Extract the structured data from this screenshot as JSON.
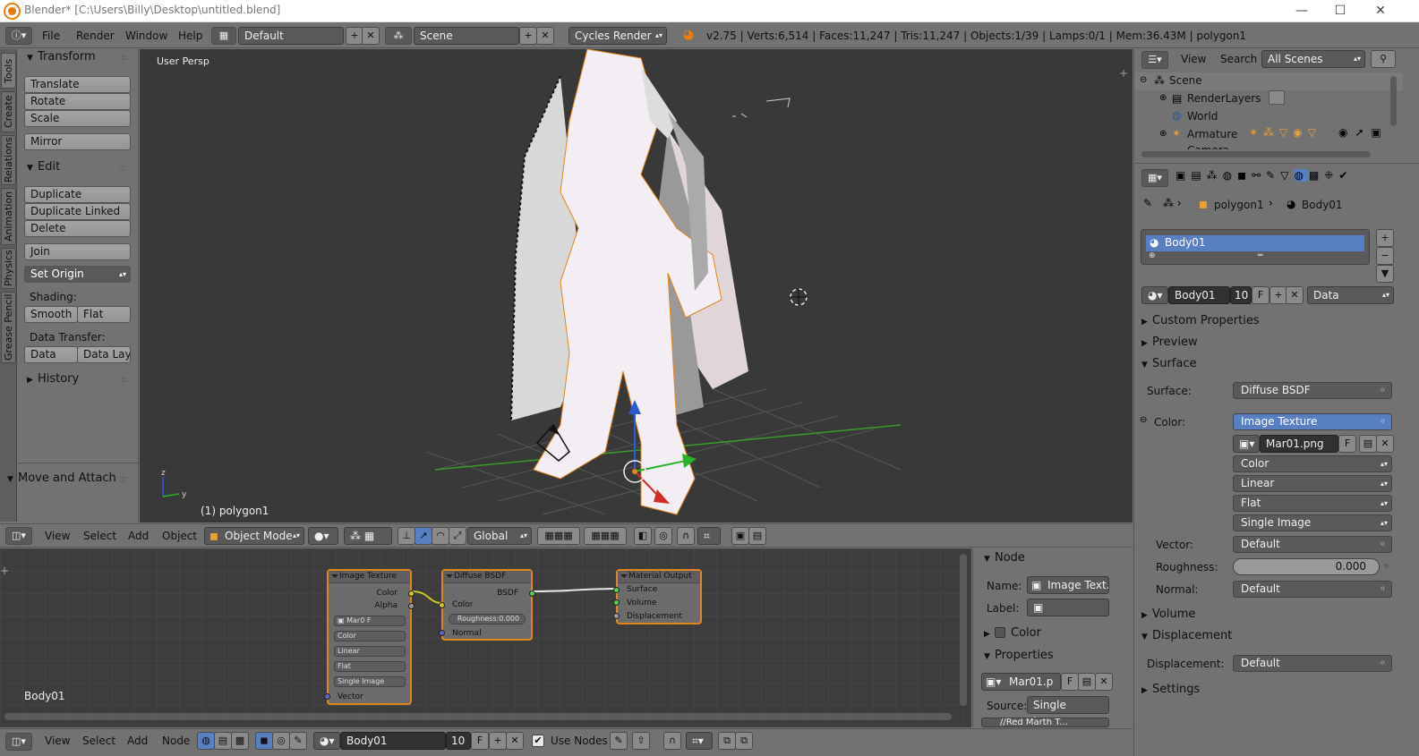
{
  "window": {
    "title": "Blender* [C:\\Users\\Billy\\Desktop\\untitled.blend]",
    "minimize": "—",
    "maximize": "☐",
    "close": "✕"
  },
  "info_header": {
    "menus": [
      "File",
      "Render",
      "Window",
      "Help"
    ],
    "layout": "Default",
    "scene": "Scene",
    "engine": "Cycles Render",
    "stats": "v2.75 | Verts:6,514 | Faces:11,247 | Tris:11,247 | Objects:1/39 | Lamps:0/1 | Mem:36.43M | polygon1"
  },
  "tool_tabs": [
    "Tools",
    "Create",
    "Relations",
    "Animation",
    "Physics",
    "Grease Pencil"
  ],
  "tool_shelf": {
    "transform_header": "Transform",
    "translate": "Translate",
    "rotate": "Rotate",
    "scale": "Scale",
    "mirror": "Mirror",
    "edit_header": "Edit",
    "duplicate": "Duplicate",
    "duplicate_linked": "Duplicate Linked",
    "delete": "Delete",
    "join": "Join",
    "set_origin": "Set Origin",
    "shading_label": "Shading:",
    "smooth": "Smooth",
    "flat": "Flat",
    "data_transfer_label": "Data Transfer:",
    "data": "Data",
    "data_layo": "Data Layo",
    "history": "History",
    "move_attach": "Move and Attach"
  },
  "viewport": {
    "view_name": "User Persp",
    "object_label": "(1) polygon1"
  },
  "viewport_header": {
    "menus": [
      "View",
      "Select",
      "Add",
      "Object"
    ],
    "mode": "Object Mode",
    "orientation": "Global"
  },
  "node_editor": {
    "material_label": "Body01",
    "image_texture": {
      "title": "Image Texture",
      "out_color": "Color",
      "out_alpha": "Alpha",
      "img": "Mar0",
      "f": "F",
      "color": "Color",
      "linear": "Linear",
      "flat": "Flat",
      "single": "Single Image",
      "vector": "Vector"
    },
    "diffuse": {
      "title": "Diffuse BSDF",
      "out": "BSDF",
      "color": "Color",
      "roughness": "Roughness:0.000",
      "normal": "Normal"
    },
    "output": {
      "title": "Material Output",
      "surface": "Surface",
      "volume": "Volume",
      "displacement": "Displacement"
    }
  },
  "node_sidebar": {
    "node_header": "Node",
    "name_label": "Name:",
    "name_value": "Image Text...",
    "label_label": "Label:",
    "color_header": "Color",
    "properties_header": "Properties",
    "image": "Mar01.p",
    "f": "F",
    "source_label": "Source:",
    "source_value": "Single Image",
    "filepath": "//Red Marth T..."
  },
  "node_header": {
    "menus": [
      "View",
      "Select",
      "Add",
      "Node"
    ],
    "material": "Body01",
    "users": "10",
    "f": "F",
    "use_nodes": "Use Nodes"
  },
  "outliner": {
    "menus": [
      "View",
      "Search"
    ],
    "scope": "All Scenes",
    "items": [
      "Scene",
      "RenderLayers",
      "World",
      "Armature",
      "Camera"
    ]
  },
  "properties": {
    "breadcrumb_obj": "polygon1",
    "breadcrumb_mat": "Body01",
    "slot": "Body01",
    "mat_name": "Body01",
    "users": "10",
    "f": "F",
    "link": "Data",
    "custom_props": "Custom Properties",
    "preview": "Preview",
    "surface_header": "Surface",
    "surface_label": "Surface:",
    "surface_value": "Diffuse BSDF",
    "color_label": "Color:",
    "color_value": "Image Texture",
    "image": "Mar01.png",
    "img_f": "F",
    "opt_color": "Color",
    "opt_linear": "Linear",
    "opt_flat": "Flat",
    "opt_single": "Single Image",
    "vector_label": "Vector:",
    "vector_value": "Default",
    "roughness_label": "Roughness:",
    "roughness_value": "0.000",
    "normal_label": "Normal:",
    "normal_value": "Default",
    "volume": "Volume",
    "displacement_header": "Displacement",
    "displacement_label": "Displacement:",
    "displacement_value": "Default",
    "settings": "Settings"
  }
}
